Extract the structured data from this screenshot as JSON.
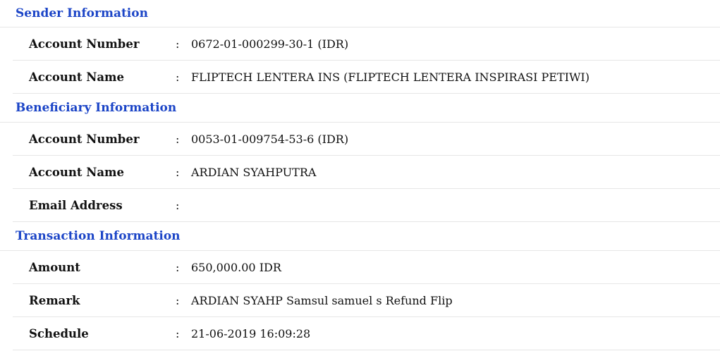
{
  "sections": [
    {
      "title": "Sender Information",
      "rows": [
        {
          "label": "Account Number",
          "separator": ":",
          "value": "0672-01-000299-30-1 (IDR)"
        },
        {
          "label": "Account Name",
          "separator": ":",
          "value": "FLIPTECH LENTERA INS (FLIPTECH LENTERA INSPIRASI PETIWI)"
        }
      ]
    },
    {
      "title": "Beneficiary Information",
      "rows": [
        {
          "label": "Account Number",
          "separator": ":",
          "value": "0053-01-009754-53-6 (IDR)"
        },
        {
          "label": "Account Name",
          "separator": ":",
          "value": "ARDIAN SYAHPUTRA"
        },
        {
          "label": "Email Address",
          "separator": ":",
          "value": ""
        }
      ]
    },
    {
      "title": "Transaction Information",
      "rows": [
        {
          "label": "Amount",
          "separator": ":",
          "value": "650,000.00 IDR"
        },
        {
          "label": "Remark",
          "separator": ":",
          "value": "ARDIAN SYAHP Samsul samuel s Refund Flip"
        },
        {
          "label": "Schedule",
          "separator": ":",
          "value": "21-06-2019 16:09:28"
        }
      ]
    }
  ],
  "colors": {
    "section_title": "#1c45c7",
    "text": "#111111",
    "divider": "#e6e6e6"
  }
}
